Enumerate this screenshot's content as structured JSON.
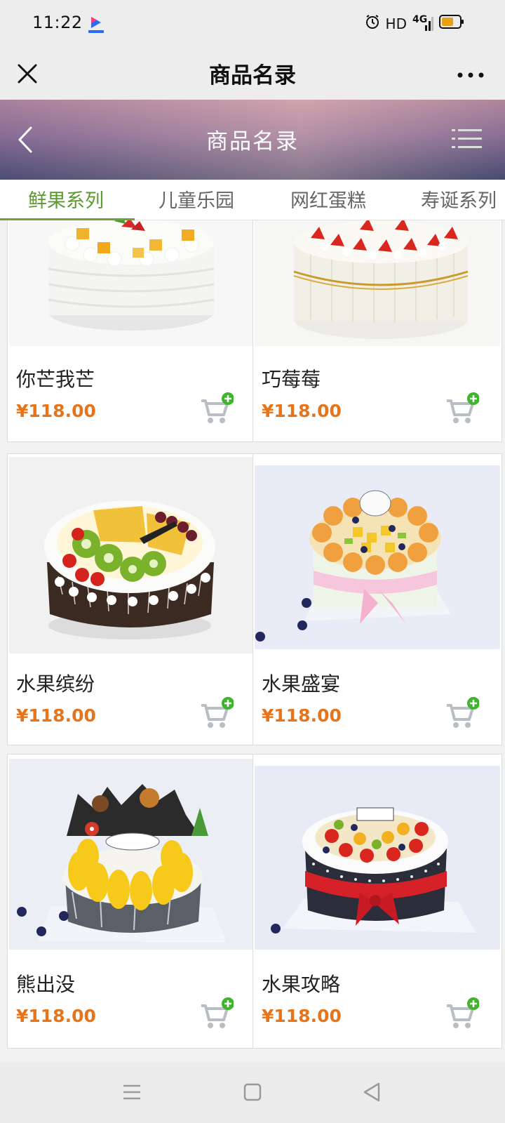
{
  "status_bar": {
    "time": "11:22",
    "network": "HD",
    "signal": "4G"
  },
  "app_bar": {
    "title": "商品名录"
  },
  "header": {
    "title": "商品名录"
  },
  "tabs": [
    {
      "label": "鲜果系列",
      "active": true
    },
    {
      "label": "儿童乐园",
      "active": false
    },
    {
      "label": "网红蛋糕",
      "active": false
    },
    {
      "label": "寿诞系列",
      "active": false
    }
  ],
  "products": [
    {
      "name": "你芒我芒",
      "price": "¥118.00"
    },
    {
      "name": "巧莓莓",
      "price": "¥118.00"
    },
    {
      "name": "水果缤纷",
      "price": "¥118.00"
    },
    {
      "name": "水果盛宴",
      "price": "¥118.00"
    },
    {
      "name": "熊出没",
      "price": "¥118.00"
    },
    {
      "name": "水果攻略",
      "price": "¥118.00"
    }
  ],
  "colors": {
    "accent_green": "#5a9a2e",
    "price_orange": "#e8741a",
    "cart_badge": "#3fb52b"
  }
}
